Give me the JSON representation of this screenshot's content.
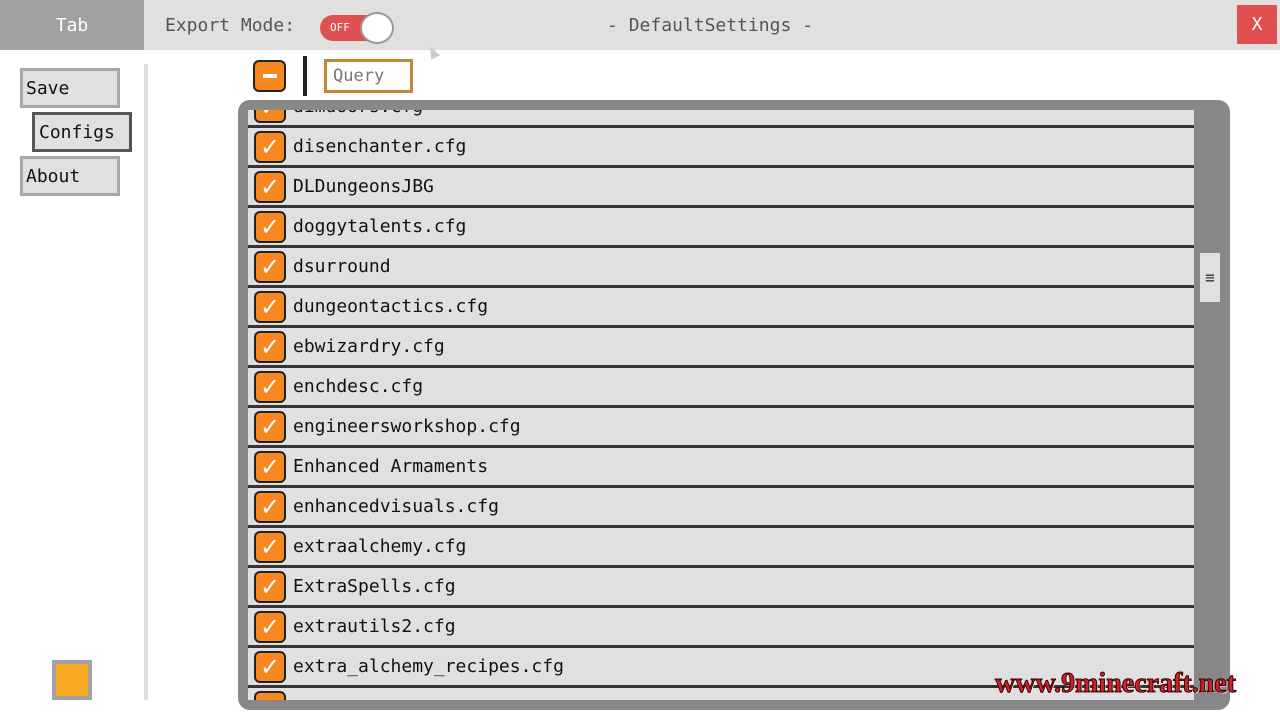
{
  "header": {
    "tab_label": "Tab",
    "export_mode_label": "Export Mode:",
    "export_toggle": {
      "state": "OFF"
    },
    "title": "- DefaultSettings -",
    "close_icon": "x-icon",
    "close_label": "X"
  },
  "sidebar": {
    "save": "Save",
    "configs": "Configs",
    "about": "About",
    "color_swatch": "#f9a825"
  },
  "toolbar": {
    "collapse_icon": "minus-icon",
    "query_placeholder": "Query"
  },
  "list": {
    "check_glyph": "✓",
    "items": [
      {
        "label": "dimdoors.cfg",
        "checked": true
      },
      {
        "label": "disenchanter.cfg",
        "checked": true
      },
      {
        "label": "DLDungeonsJBG",
        "checked": true
      },
      {
        "label": "doggytalents.cfg",
        "checked": true
      },
      {
        "label": "dsurround",
        "checked": true
      },
      {
        "label": "dungeontactics.cfg",
        "checked": true
      },
      {
        "label": "ebwizardry.cfg",
        "checked": true
      },
      {
        "label": "enchdesc.cfg",
        "checked": true
      },
      {
        "label": "engineersworkshop.cfg",
        "checked": true
      },
      {
        "label": "Enhanced Armaments",
        "checked": true
      },
      {
        "label": "enhancedvisuals.cfg",
        "checked": true
      },
      {
        "label": "extraalchemy.cfg",
        "checked": true
      },
      {
        "label": "ExtraSpells.cfg",
        "checked": true
      },
      {
        "label": "extrautils2.cfg",
        "checked": true
      },
      {
        "label": "extra_alchemy_recipes.cfg",
        "checked": true
      },
      {
        "label": "",
        "checked": true
      }
    ],
    "scroll_glyph": "≡"
  },
  "colors": {
    "accent": "#f7871f",
    "close": "#e05050"
  },
  "watermark": "www.9minecraft.net"
}
